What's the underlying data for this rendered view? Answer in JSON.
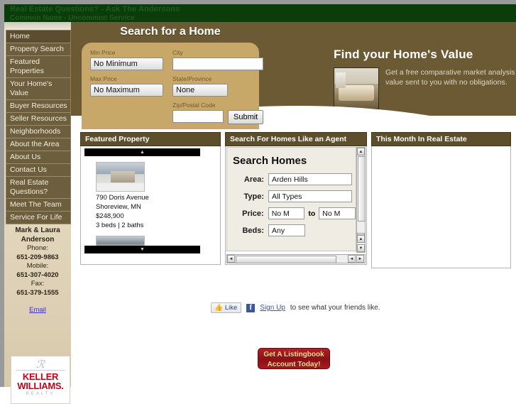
{
  "header": {
    "tagline": "Real Estate Questions? - Ask The Andersons",
    "subtagline": "Common Name - Uncommon Service"
  },
  "sidebar": {
    "items": [
      {
        "label": "Home",
        "active": true
      },
      {
        "label": "Property Search",
        "active": false
      },
      {
        "label": "Featured Properties",
        "active": false
      },
      {
        "label": "Your Home's Value",
        "active": false
      },
      {
        "label": "Buyer Resources",
        "active": false
      },
      {
        "label": "Seller Resources",
        "active": false
      },
      {
        "label": "Neighborhoods",
        "active": false
      },
      {
        "label": "About the Area",
        "active": false
      },
      {
        "label": "About Us",
        "active": false
      },
      {
        "label": "Contact Us",
        "active": false
      },
      {
        "label": "Real Estate\nQuestions?",
        "active": false
      },
      {
        "label": "Meet The Team",
        "active": false
      },
      {
        "label": "Service For Life",
        "active": false
      }
    ],
    "contact": {
      "name_line1": "Mark & Laura",
      "name_line2": "Anderson",
      "phone_label": "Phone:",
      "phone": "651-209-9863",
      "mobile_label": "Mobile:",
      "mobile": "651-307-4020",
      "fax_label": "Fax:",
      "fax": "651-379-1555",
      "email_link": "Email"
    },
    "logo": {
      "main_line1": "KELLER",
      "main_line2": "WILLIAMS.",
      "sub": "REALTY"
    }
  },
  "search_panel": {
    "title": "Search for a Home",
    "min_price_label": "Min Price",
    "min_price_value": "No Minimum",
    "max_price_label": "Max Price",
    "max_price_value": "No Maximum",
    "city_label": "City",
    "city_value": "",
    "state_label": "State/Province",
    "state_value": "None",
    "zip_label": "Zip/Postal Code",
    "zip_value": "",
    "submit_label": "Submit"
  },
  "home_value": {
    "title": "Find your Home's Value",
    "description": "Get a free comparative market analysis of your home's value sent to you with no obligations."
  },
  "panels": {
    "featured": {
      "heading": "Featured Property",
      "address": "790 Doris Avenue",
      "city_state": "Shoreview, MN",
      "price": "$248,900",
      "beds_baths": "3 beds | 2 baths",
      "scroll_up_icon": "▲",
      "scroll_down_icon": "▼"
    },
    "agent": {
      "heading": "Search For Homes Like an Agent",
      "title": "Search Homes",
      "fields": [
        {
          "label": "Area:",
          "value": "Arden Hills"
        },
        {
          "label": "Type:",
          "value": "All Types"
        },
        {
          "label": "Price:",
          "value": "No M",
          "value2": "No M",
          "between": "to"
        },
        {
          "label": "Beds:",
          "value": "Any"
        }
      ]
    },
    "month": {
      "heading": "This Month In Real Estate"
    }
  },
  "facebook": {
    "like_label": "Like",
    "thumb_icon": "👍",
    "f_glyph": "f",
    "signup_label": "Sign Up",
    "tail_text": "to see what your friends like."
  },
  "listingbook": {
    "line1": "Get A Listingbook",
    "line2": "Account Today!"
  },
  "icons": {
    "arrow_down": "▼",
    "arrow_up": "▲",
    "arrow_left": "◄",
    "arrow_right": "►"
  }
}
